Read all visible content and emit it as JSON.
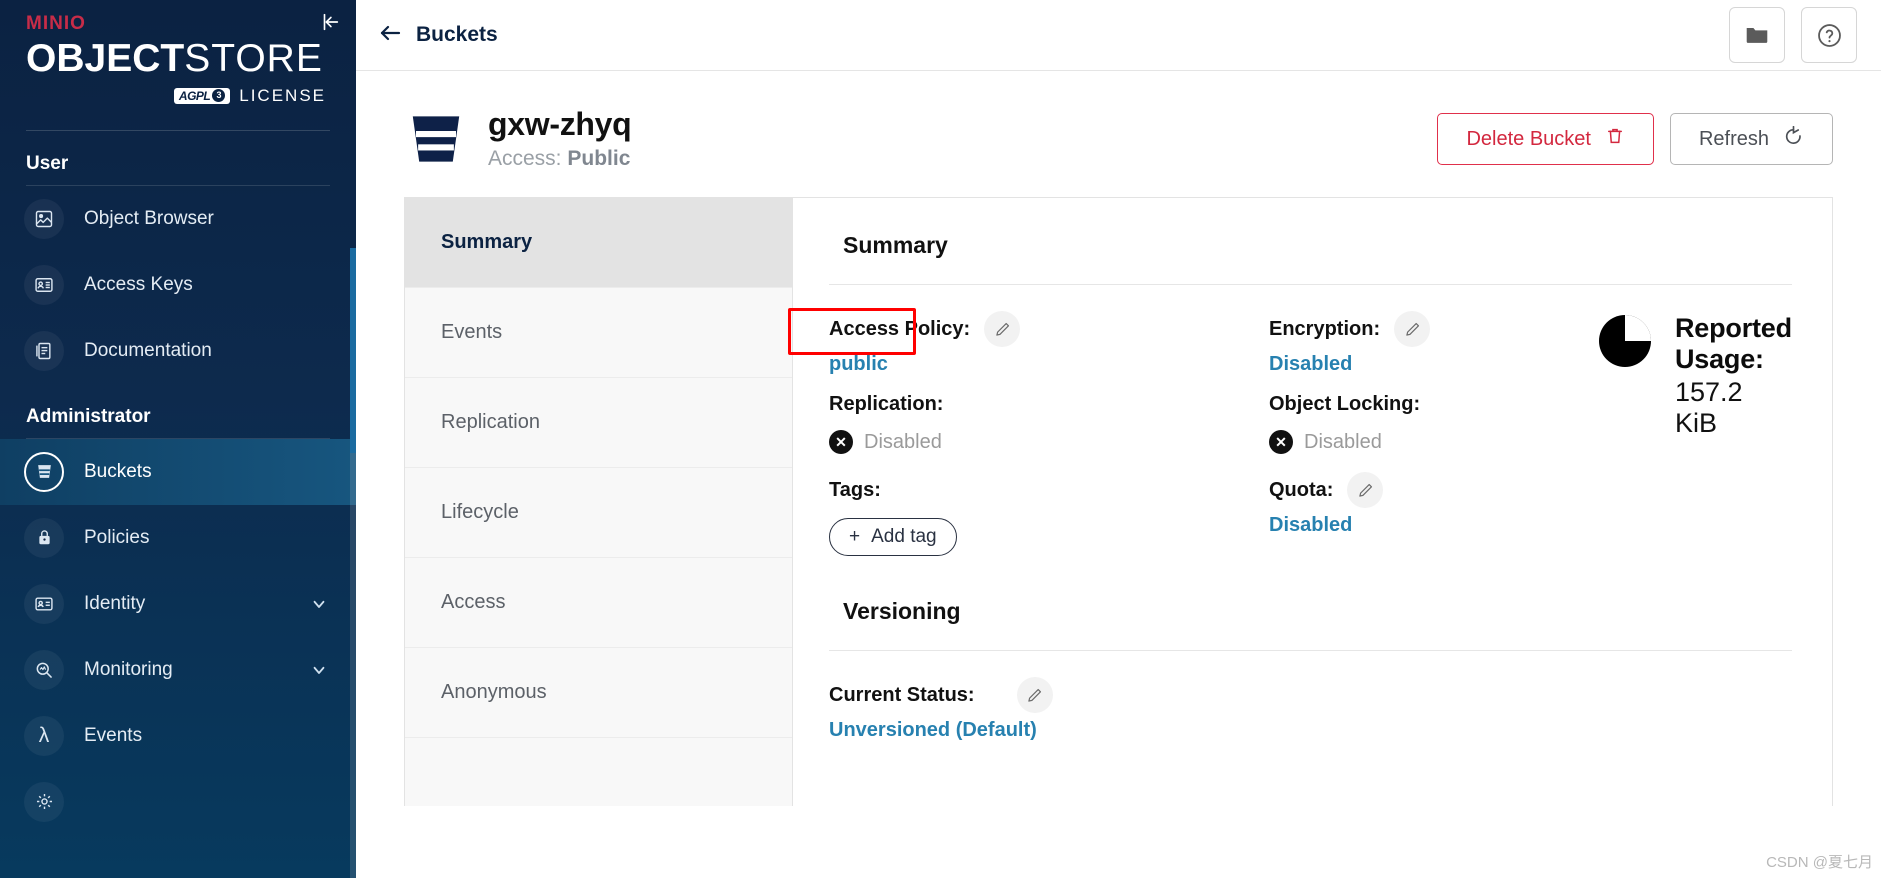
{
  "sidebar": {
    "brand": {
      "minio": "MINIO",
      "object": "OBJECT",
      "store": "STORE",
      "agpl": "AGPL",
      "agpl_v": "3",
      "license": "LICENSE"
    },
    "collapse_icon": "collapse-left-icon",
    "sections": [
      {
        "title": "User",
        "items": [
          {
            "label": "Object Browser",
            "icon": "object-browser-icon",
            "active": false,
            "expandable": false
          },
          {
            "label": "Access Keys",
            "icon": "access-keys-icon",
            "active": false,
            "expandable": false
          },
          {
            "label": "Documentation",
            "icon": "documentation-icon",
            "active": false,
            "expandable": false
          }
        ]
      },
      {
        "title": "Administrator",
        "items": [
          {
            "label": "Buckets",
            "icon": "bucket-icon",
            "active": true,
            "expandable": false
          },
          {
            "label": "Policies",
            "icon": "lock-icon",
            "active": false,
            "expandable": false
          },
          {
            "label": "Identity",
            "icon": "identity-card-icon",
            "active": false,
            "expandable": true
          },
          {
            "label": "Monitoring",
            "icon": "monitoring-icon",
            "active": false,
            "expandable": true
          },
          {
            "label": "Events",
            "icon": "lambda-icon",
            "active": false,
            "expandable": false
          }
        ]
      }
    ]
  },
  "topbar": {
    "back_label": "Buckets",
    "back_icon": "arrow-left-icon",
    "folder_icon": "folder-icon",
    "help_icon": "help-circle-icon"
  },
  "bucket": {
    "name": "gxw-zhyq",
    "access_label": "Access:",
    "access_value": "Public",
    "icon": "bucket-icon"
  },
  "actions": {
    "delete_label": "Delete Bucket",
    "delete_icon": "trash-icon",
    "refresh_label": "Refresh",
    "refresh_icon": "refresh-icon"
  },
  "tabs": [
    {
      "label": "Summary",
      "active": true
    },
    {
      "label": "Events",
      "active": false
    },
    {
      "label": "Replication",
      "active": false
    },
    {
      "label": "Lifecycle",
      "active": false
    },
    {
      "label": "Access",
      "active": false
    },
    {
      "label": "Anonymous",
      "active": false
    }
  ],
  "summary": {
    "title": "Summary",
    "access_policy": {
      "label": "Access Policy:",
      "value": "public",
      "edit_icon": "pencil-icon",
      "highlighted": true
    },
    "replication": {
      "label": "Replication:",
      "value": "Disabled",
      "status_icon": "x-circle-icon"
    },
    "tags": {
      "label": "Tags:",
      "add_label": "Add tag",
      "add_icon": "plus-icon"
    },
    "encryption": {
      "label": "Encryption:",
      "value": "Disabled",
      "edit_icon": "pencil-icon"
    },
    "object_locking": {
      "label": "Object Locking:",
      "value": "Disabled",
      "status_icon": "x-circle-icon"
    },
    "quota": {
      "label": "Quota:",
      "value": "Disabled",
      "edit_icon": "pencil-icon"
    },
    "usage": {
      "title": "Reported Usage:",
      "value": "157.2 KiB",
      "icon": "pie-chart-icon"
    }
  },
  "versioning": {
    "title": "Versioning",
    "current_status_label": "Current Status:",
    "current_status_value": "Unversioned (Default)",
    "edit_icon": "pencil-icon"
  },
  "watermark": "CSDN @夏七月",
  "colors": {
    "brand_red": "#c72c48",
    "sidebar_dark": "#0b2242",
    "link_blue": "#2781b0",
    "danger": "#d3283f",
    "highlight": "#ff0000",
    "active_tab_bg": "#e3e3e3"
  }
}
